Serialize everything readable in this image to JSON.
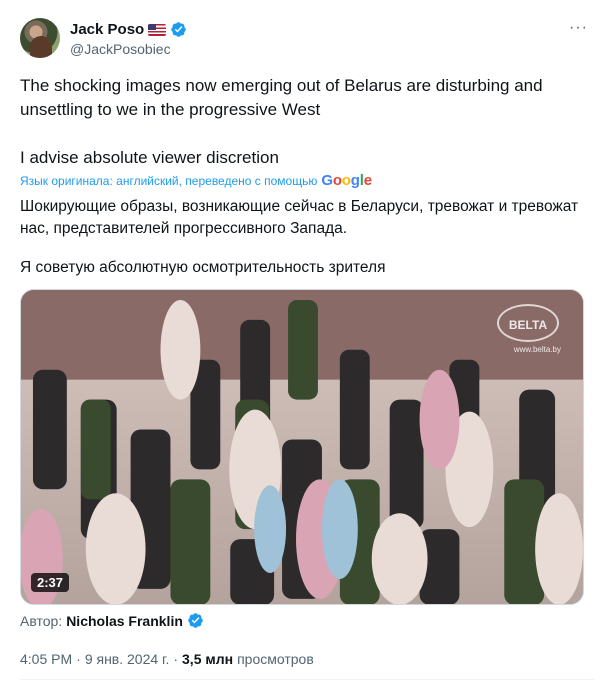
{
  "tweet": {
    "author": {
      "display_name": "Jack Poso",
      "handle": "@JackPosobiec",
      "flag_icon": "us-flag-icon",
      "verified_icon": "verified-badge-icon"
    },
    "more_icon": "more-horizontal-icon",
    "text_original_1": "The shocking images now emerging out of Belarus are disturbing and unsettling to we in the progressive West",
    "text_original_2": "I advise absolute viewer discretion",
    "translation_label": "Язык оригинала: английский, переведено с помощью",
    "translation_provider": "Google",
    "text_translated_1": "Шокирующие образы, возникающие сейчас в Беларуси, тревожат и тревожат нас, представителей прогрессивного Запада.",
    "text_translated_2": "Я советую абсолютную осмотрительность зрителя",
    "video": {
      "duration": "2:37",
      "watermark": "BELTA",
      "watermark_url": "www.belta.by"
    },
    "media_author_label": "Автор:",
    "media_author_name": "Nicholas Franklin",
    "time": "4:05 PM",
    "date": "9 янв. 2024 г.",
    "views_count": "3,5 млн",
    "views_label": "просмотров"
  },
  "colors": {
    "accent": "#1d9bf0",
    "text_primary": "#0f1419",
    "text_secondary": "#536471"
  }
}
